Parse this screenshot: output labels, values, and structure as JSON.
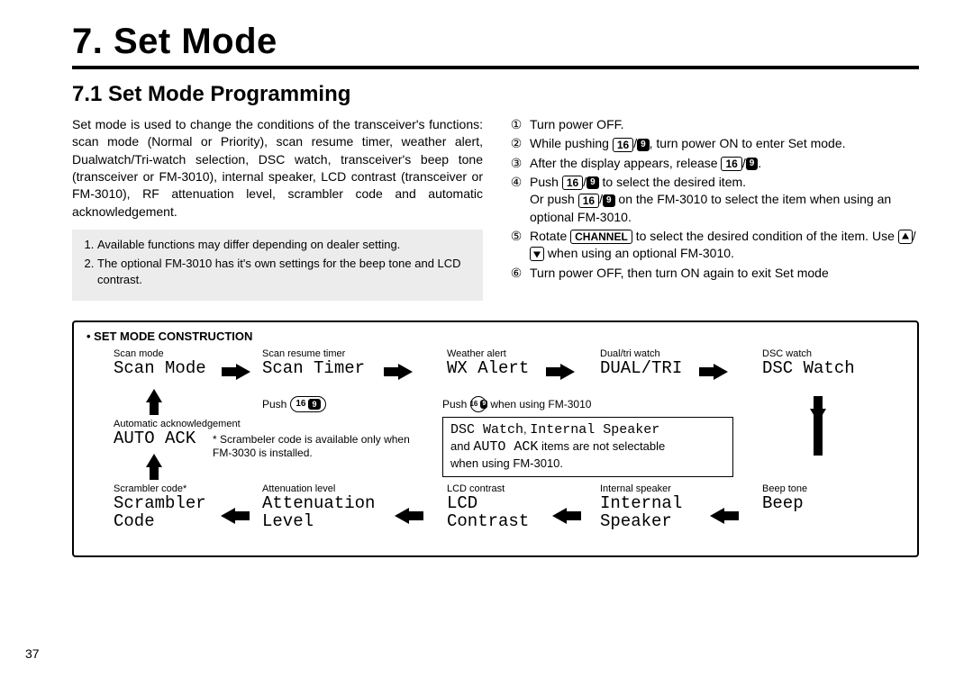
{
  "page_number": "37",
  "title": "7. Set Mode",
  "section": "7.1 Set Mode Programming",
  "intro": "Set mode is used to change the conditions of the transceiver's functions: scan mode (Normal or Priority), scan resume timer, weather alert, Dualwatch/Tri-watch selection, DSC watch, transceiver's beep tone (transceiver or FM-3010), internal speaker, LCD contrast (transceiver or FM-3010), RF attenuation level, scrambler code and automatic acknowledgement.",
  "notes": [
    "Available functions may differ depending on dealer setting.",
    "The optional FM-3010 has it's own settings for the beep tone and LCD contrast."
  ],
  "steps": {
    "s1": "Turn power OFF.",
    "s2a": "While pushing ",
    "s2b": ", turn power ON to enter Set mode.",
    "s3a": "After the display appears, release ",
    "s3b": ".",
    "s4a": "Push ",
    "s4b": " to select the desired item.",
    "s4c": "Or push ",
    "s4d": " on the FM-3010 to select the item when using an optional FM-3010.",
    "s5a": "Rotate ",
    "s5b": " to select the desired condition of the item. Use ",
    "s5c": " when using an optional FM-3010.",
    "s6": "Turn power OFF, then turn ON again to exit Set mode"
  },
  "buttons": {
    "sixteen": "16",
    "nine": "9",
    "channel": "CHANNEL",
    "sixteen_nine_round": "16 9"
  },
  "diagram": {
    "heading": "• SET MODE CONSTRUCTION",
    "cells": {
      "scan_mode": {
        "label": "Scan mode",
        "lcd": "Scan Mode"
      },
      "scan_timer": {
        "label": "Scan resume timer",
        "lcd": "Scan Timer"
      },
      "wx_alert": {
        "label": "Weather alert",
        "lcd": "WX Alert"
      },
      "dual_tri": {
        "label": "Dual/tri watch",
        "lcd": "DUAL/TRI"
      },
      "dsc_watch": {
        "label": "DSC watch",
        "lcd": "DSC Watch"
      },
      "auto_ack": {
        "label": "Automatic acknowledgement",
        "lcd": "AUTO ACK"
      },
      "scrambler": {
        "label": "Scrambler code*",
        "lcd": "Scrambler\nCode"
      },
      "atten": {
        "label": "Attenuation level",
        "lcd": "Attenuation\nLevel"
      },
      "lcd": {
        "label": "LCD contrast",
        "lcd": "LCD\nContrast"
      },
      "int_spk": {
        "label": "Internal speaker",
        "lcd": "Internal\nSpeaker"
      },
      "beep": {
        "label": "Beep tone",
        "lcd": "Beep"
      }
    },
    "push_label": "Push",
    "push_fm_label": "Push",
    "push_fm_suffix": "when using FM-3010",
    "sub_note_line1_a": "DSC Watch",
    "sub_note_line1_b": "Internal Speaker",
    "sub_note_line1_comma": ", ",
    "sub_note_line2a": "and ",
    "sub_note_line2b": "AUTO ACK",
    "sub_note_line2c": " items are not selectable",
    "sub_note_line3": "when using FM-3010.",
    "scram_note": "* Scrambeler code is available only when FM-3030 is installed."
  }
}
